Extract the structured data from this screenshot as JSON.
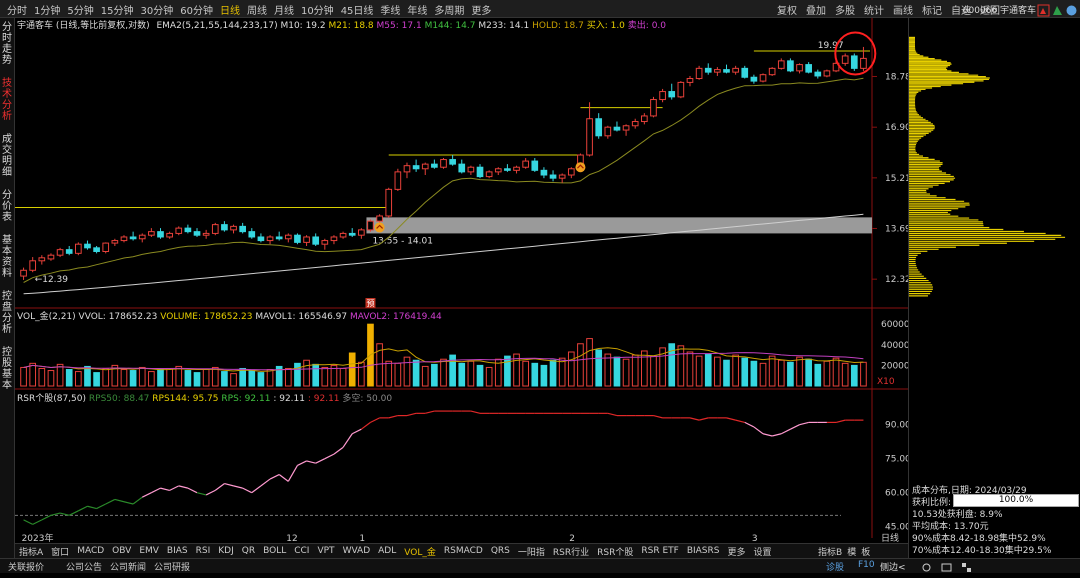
{
  "toolbar": {
    "items": [
      "分时",
      "1分钟",
      "5分钟",
      "15分钟",
      "30分钟",
      "60分钟",
      "日线",
      "周线",
      "月线",
      "10分钟",
      "45日线",
      "季线",
      "年线",
      "多周期",
      "更多"
    ],
    "selected_index": 6,
    "right": [
      "复权",
      "叠加",
      "多股",
      "统计",
      "画线",
      "标记",
      "自选",
      "返回"
    ],
    "stock": "600066 宇通客车"
  },
  "sidebar": [
    "分时走势",
    "技术分析",
    "成交明细",
    "分价表",
    "基本资料",
    "控盘分析",
    "控股基本"
  ],
  "sidebar_active": 1,
  "main_legend": {
    "name": "宇通客车 (日线,等比前复权,对数)",
    "ema_label": "EMA2(5,21,55,144,233,17)",
    "m10": "M10: 19.2",
    "m21": "M21: 18.8",
    "m55": "M55: 17.1",
    "m144": "M144: 14.7",
    "m233": "M233: 14.1",
    "hold": "HOLD: 18.7",
    "buy": "买入: 1.0",
    "sell": "卖出: 0.0"
  },
  "price_axis": [
    "18.78",
    "16.90",
    "15.21",
    "13.69",
    "12.32"
  ],
  "annotations": {
    "high": "19.97",
    "low": "12.39",
    "range": "13.55 - 14.01",
    "mark": "预"
  },
  "vol_legend": {
    "name": "VOL_金(2,21)",
    "vvol": "VVOL: 178652.23",
    "volume": "VOLUME: 178652.23",
    "mavol1": "MAVOL1: 165546.97",
    "mavol2": "MAVOL2: 176419.44"
  },
  "vol_axis": [
    "60000",
    "40000",
    "20000"
  ],
  "vol_unit": "X10",
  "rsr_legend": {
    "name": "RSR个股(87,50)",
    "rps50": "RPS50: 88.47",
    "rps144": "RPS144: 95.75",
    "rps": "RPS: 92.11",
    "v1": ": 92.11",
    "v2": ": 92.11",
    "multi": "多空: 50.00"
  },
  "rsr_axis": [
    "90.00",
    "75.00",
    "60.00",
    "45.00"
  ],
  "date_axis": [
    "2023年",
    "12",
    "1",
    "2",
    "3"
  ],
  "date_axis_right": "日线",
  "bottom_tabs": [
    "指标A",
    "窗口",
    "MACD",
    "OBV",
    "EMV",
    "BIAS",
    "RSI",
    "KDJ",
    "QR",
    "BOLL",
    "CCI",
    "VPT",
    "WVAD",
    "ADL",
    "VOL_金",
    "RSMACD",
    "QRS",
    "一阳指",
    "RSR行业",
    "RSR个股",
    "RSR ETF",
    "BIASRS",
    "更多",
    "设置"
  ],
  "bottom_active": 14,
  "bottom_right": [
    "指标B",
    "模",
    "板"
  ],
  "status": [
    "关联报价",
    "公司公告",
    "公司新闻",
    "公司研报"
  ],
  "status_right": [
    "诊股",
    "F10",
    "侧边<"
  ],
  "cost": {
    "date": "成本分布,日期: 2024/03/29",
    "profit_label": "获利比例:",
    "profit": "100.0%",
    "profit_at": "10.53处获利盘: 8.9%",
    "avg": "平均成本: 13.70元",
    "c90": "90%成本8.42-18.98集中52.9%",
    "c70": "70%成本12.40-18.30集中29.5%"
  },
  "chart_data": {
    "type": "candlestick",
    "ohlc": [
      [
        12.4,
        12.62,
        12.3,
        12.55
      ],
      [
        12.55,
        12.9,
        12.5,
        12.8
      ],
      [
        12.8,
        12.95,
        12.7,
        12.88
      ],
      [
        12.85,
        13.0,
        12.8,
        12.95
      ],
      [
        12.95,
        13.15,
        12.9,
        13.1
      ],
      [
        13.1,
        13.2,
        12.95,
        13.0
      ],
      [
        13.0,
        13.3,
        12.95,
        13.25
      ],
      [
        13.25,
        13.35,
        13.1,
        13.15
      ],
      [
        13.15,
        13.2,
        13.0,
        13.05
      ],
      [
        13.05,
        13.3,
        13.0,
        13.28
      ],
      [
        13.28,
        13.4,
        13.2,
        13.35
      ],
      [
        13.35,
        13.5,
        13.3,
        13.45
      ],
      [
        13.45,
        13.6,
        13.35,
        13.4
      ],
      [
        13.4,
        13.55,
        13.3,
        13.5
      ],
      [
        13.5,
        13.7,
        13.45,
        13.6
      ],
      [
        13.6,
        13.7,
        13.4,
        13.45
      ],
      [
        13.45,
        13.6,
        13.4,
        13.55
      ],
      [
        13.55,
        13.75,
        13.5,
        13.7
      ],
      [
        13.7,
        13.8,
        13.55,
        13.6
      ],
      [
        13.6,
        13.7,
        13.45,
        13.5
      ],
      [
        13.5,
        13.65,
        13.4,
        13.55
      ],
      [
        13.55,
        13.85,
        13.5,
        13.8
      ],
      [
        13.8,
        13.9,
        13.6,
        13.65
      ],
      [
        13.65,
        13.8,
        13.55,
        13.75
      ],
      [
        13.75,
        13.85,
        13.55,
        13.6
      ],
      [
        13.6,
        13.7,
        13.4,
        13.45
      ],
      [
        13.45,
        13.55,
        13.3,
        13.35
      ],
      [
        13.35,
        13.5,
        13.25,
        13.45
      ],
      [
        13.45,
        13.6,
        13.35,
        13.4
      ],
      [
        13.4,
        13.55,
        13.3,
        13.5
      ],
      [
        13.5,
        13.55,
        13.25,
        13.3
      ],
      [
        13.3,
        13.5,
        13.2,
        13.45
      ],
      [
        13.45,
        13.55,
        13.2,
        13.25
      ],
      [
        13.25,
        13.4,
        13.1,
        13.35
      ],
      [
        13.35,
        13.5,
        13.25,
        13.45
      ],
      [
        13.45,
        13.6,
        13.4,
        13.55
      ],
      [
        13.55,
        13.7,
        13.45,
        13.5
      ],
      [
        13.5,
        13.7,
        13.4,
        13.65
      ],
      [
        13.65,
        13.95,
        13.6,
        13.9
      ],
      [
        13.9,
        14.1,
        13.8,
        14.05
      ],
      [
        14.05,
        14.9,
        14.0,
        14.85
      ],
      [
        14.85,
        15.5,
        14.8,
        15.4
      ],
      [
        15.4,
        15.7,
        15.2,
        15.6
      ],
      [
        15.6,
        15.8,
        15.4,
        15.5
      ],
      [
        15.5,
        15.7,
        15.3,
        15.65
      ],
      [
        15.65,
        15.8,
        15.5,
        15.55
      ],
      [
        15.55,
        15.85,
        15.5,
        15.8
      ],
      [
        15.8,
        15.95,
        15.6,
        15.65
      ],
      [
        15.65,
        15.8,
        15.35,
        15.4
      ],
      [
        15.4,
        15.6,
        15.3,
        15.55
      ],
      [
        15.55,
        15.65,
        15.2,
        15.25
      ],
      [
        15.25,
        15.45,
        15.2,
        15.4
      ],
      [
        15.4,
        15.55,
        15.3,
        15.5
      ],
      [
        15.5,
        15.65,
        15.4,
        15.45
      ],
      [
        15.45,
        15.6,
        15.35,
        15.55
      ],
      [
        15.55,
        15.85,
        15.5,
        15.75
      ],
      [
        15.75,
        15.85,
        15.4,
        15.45
      ],
      [
        15.45,
        15.55,
        15.2,
        15.3
      ],
      [
        15.3,
        15.45,
        15.1,
        15.2
      ],
      [
        15.2,
        15.35,
        15.05,
        15.3
      ],
      [
        15.3,
        15.55,
        15.2,
        15.5
      ],
      [
        15.5,
        16.0,
        15.45,
        15.95
      ],
      [
        15.95,
        17.8,
        15.9,
        17.2
      ],
      [
        17.2,
        17.4,
        16.5,
        16.6
      ],
      [
        16.6,
        16.95,
        16.5,
        16.9
      ],
      [
        16.9,
        17.1,
        16.75,
        16.8
      ],
      [
        16.8,
        17.0,
        16.6,
        16.95
      ],
      [
        16.95,
        17.2,
        16.85,
        17.1
      ],
      [
        17.1,
        17.4,
        17.0,
        17.3
      ],
      [
        17.3,
        18.0,
        17.25,
        17.9
      ],
      [
        17.9,
        18.3,
        17.8,
        18.2
      ],
      [
        18.2,
        18.5,
        17.9,
        18.0
      ],
      [
        18.0,
        18.6,
        17.95,
        18.55
      ],
      [
        18.55,
        18.8,
        18.4,
        18.7
      ],
      [
        18.7,
        19.2,
        18.65,
        19.1
      ],
      [
        19.1,
        19.3,
        18.85,
        18.95
      ],
      [
        18.95,
        19.15,
        18.8,
        19.05
      ],
      [
        19.05,
        19.25,
        18.9,
        18.95
      ],
      [
        18.95,
        19.2,
        18.85,
        19.1
      ],
      [
        19.1,
        19.2,
        18.7,
        18.75
      ],
      [
        18.75,
        18.85,
        18.5,
        18.6
      ],
      [
        18.6,
        18.9,
        18.55,
        18.85
      ],
      [
        18.85,
        19.15,
        18.8,
        19.1
      ],
      [
        19.1,
        19.5,
        19.05,
        19.4
      ],
      [
        19.4,
        19.5,
        18.95,
        19.0
      ],
      [
        19.0,
        19.3,
        18.9,
        19.25
      ],
      [
        19.25,
        19.35,
        18.9,
        18.95
      ],
      [
        18.95,
        19.05,
        18.7,
        18.8
      ],
      [
        18.8,
        19.05,
        18.75,
        19.0
      ],
      [
        19.0,
        19.4,
        18.95,
        19.3
      ],
      [
        19.3,
        19.7,
        19.2,
        19.6
      ],
      [
        19.6,
        19.7,
        19.0,
        19.1
      ],
      [
        19.1,
        19.97,
        19.0,
        19.5
      ]
    ],
    "volume": [
      18,
      22,
      17,
      15,
      21,
      16,
      14,
      19,
      13,
      17,
      20,
      16,
      15,
      18,
      14,
      16,
      17,
      19,
      15,
      13,
      16,
      18,
      14,
      12,
      17,
      15,
      13,
      16,
      19,
      17,
      22,
      25,
      21,
      18,
      20,
      17,
      32,
      23,
      60,
      41,
      24,
      22,
      28,
      25,
      19,
      21,
      26,
      30,
      22,
      24,
      20,
      18,
      26,
      29,
      31,
      24,
      22,
      20,
      25,
      27,
      33,
      41,
      46,
      35,
      31,
      28,
      26,
      30,
      34,
      29,
      37,
      41,
      39,
      33,
      29,
      31,
      28,
      25,
      30,
      27,
      24,
      22,
      29,
      25,
      23,
      28,
      26,
      21,
      24,
      27,
      22,
      20,
      23
    ],
    "rsr": [
      48,
      46,
      48,
      50,
      51,
      50,
      52,
      54,
      53,
      55,
      57,
      56,
      55,
      58,
      60,
      62,
      61,
      63,
      62,
      60,
      59,
      61,
      64,
      63,
      62,
      60,
      63,
      66,
      68,
      65,
      72,
      74,
      73,
      75,
      77,
      80,
      86,
      88,
      91,
      93,
      93,
      94,
      94,
      95,
      95,
      96,
      96,
      96,
      96,
      96,
      95,
      95,
      95,
      95,
      95,
      95,
      95,
      95,
      95,
      95,
      95,
      95,
      95,
      95,
      95,
      94,
      94,
      94,
      94,
      94,
      93,
      93,
      93,
      93,
      92,
      93,
      93,
      93,
      92,
      91,
      89,
      86,
      85,
      86,
      88,
      90,
      91,
      91,
      91,
      91,
      92,
      92,
      92
    ]
  }
}
